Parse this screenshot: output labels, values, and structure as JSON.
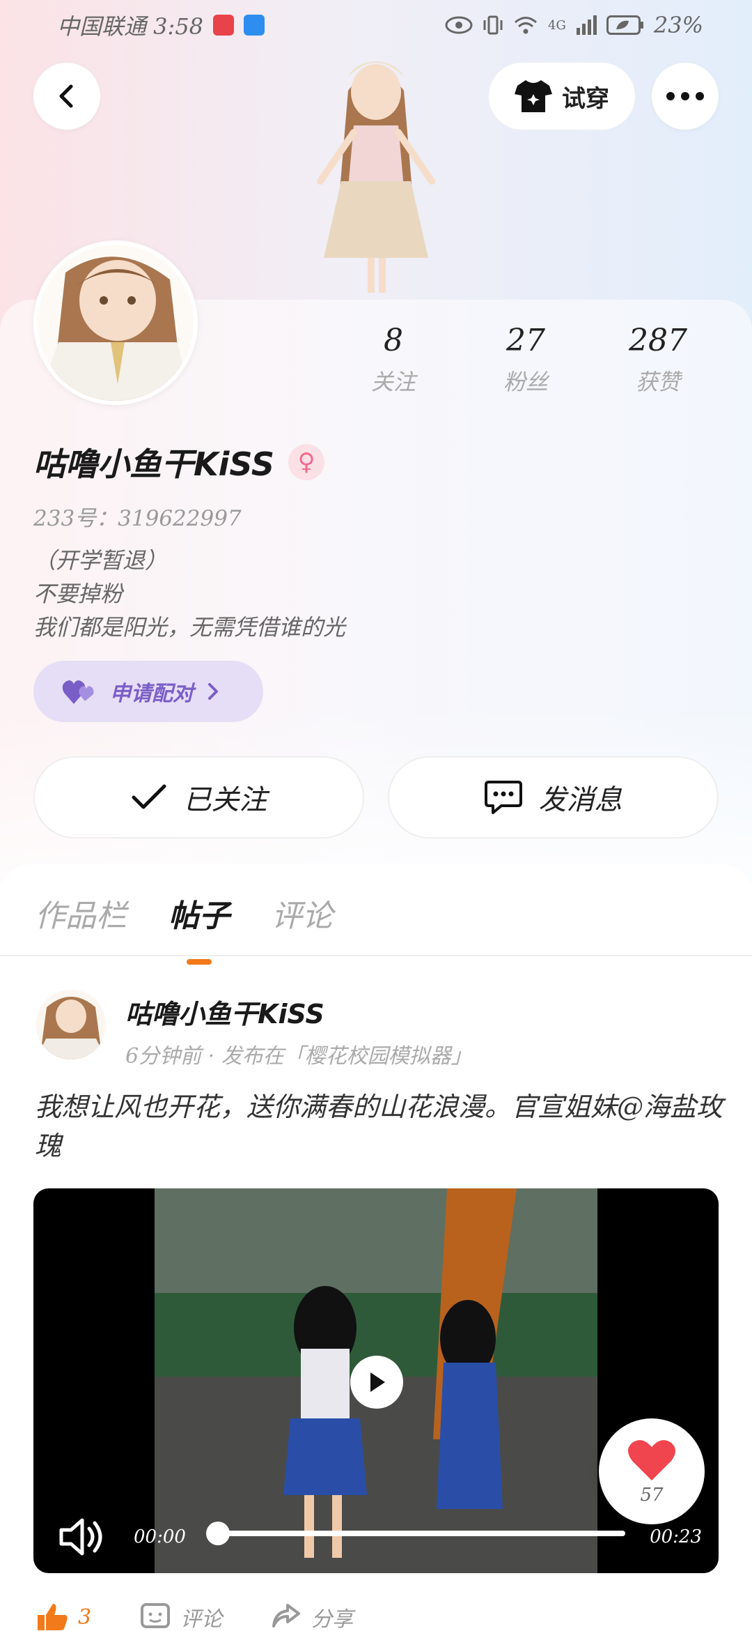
{
  "status_bar": {
    "carrier_time": "中国联通 3:58",
    "network": "4G",
    "battery": "23%"
  },
  "header": {
    "try_on_label": "试穿"
  },
  "profile": {
    "stats": [
      {
        "num": "8",
        "label": "关注"
      },
      {
        "num": "27",
        "label": "粉丝"
      },
      {
        "num": "287",
        "label": "获赞"
      }
    ],
    "nickname": "咕噜小鱼干KiSS",
    "gender_symbol": "♀",
    "uid": "233号：319622997",
    "bio_lines": [
      "（开学暂退）",
      "不要掉粉",
      "我们都是阳光，无需凭借谁的光"
    ],
    "pair_label": "申请配对",
    "follow_label": "已关注",
    "message_label": "发消息"
  },
  "tabs": [
    {
      "label": "作品栏",
      "active": false
    },
    {
      "label": "帖子",
      "active": true
    },
    {
      "label": "评论",
      "active": false
    }
  ],
  "post": {
    "author": "咕噜小鱼干KiSS",
    "meta": "6分钟前 · 发布在「樱花校园模拟器」",
    "text": "我想让风也开花，送你满春的山花浪漫。官宣姐妹@海盐玫瑰",
    "video": {
      "current_time": "00:00",
      "total_time": "00:23",
      "progress": 0
    },
    "float_like_count": "57",
    "likes": "3",
    "comment_label": "评论",
    "share_label": "分享"
  },
  "colors": {
    "accent_orange": "#f27a1a",
    "pair_purple": "#7a5ec7",
    "heart_red": "#f0444e"
  }
}
